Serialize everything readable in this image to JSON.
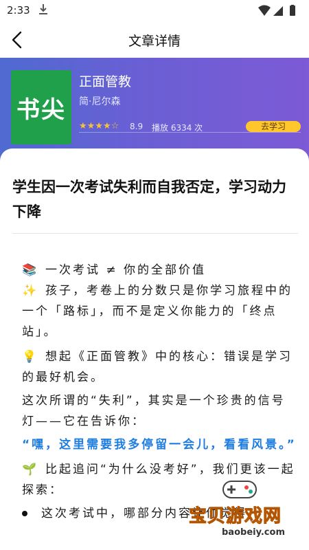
{
  "status_bar": {
    "time": "2:33"
  },
  "app_bar": {
    "title": "文章详情"
  },
  "book": {
    "cover_text": "书尖",
    "title": "正面管教",
    "author": "简·尼尔森",
    "stars": "★★★★☆",
    "rating": "8.9",
    "plays": "播放 6334 次",
    "learn_button": "去学习"
  },
  "article": {
    "title": "学生因一次考试失利而自我否定，学习动力下降",
    "lines": {
      "l1": "一次考试 ≠ 你的全部价值",
      "l2": "孩子，考卷上的分数只是你学习旅程中的一个「路标」，而不是定义你能力的「终点站」。",
      "l3": "想起《正面管教》中的核心：错误是学习的最好机会。",
      "l4": "这次所谓的“失利”，其实是一个珍贵的信号灯——它在告诉你：",
      "l5": "“嘿，这里需要我多停留一会儿，看看风景。”",
      "l6": "比起追问“为什么没考好”，我们更该一起探索：",
      "l7": "这次考试中，哪部分内容让你觉得"
    }
  },
  "watermark": {
    "text": "宝贝游戏网",
    "url": "baobeiy.com"
  },
  "icons": {
    "back": "back-arrow-icon",
    "download": "download-icon",
    "wifi": "wifi-icon",
    "signal": "signal-icon",
    "battery": "battery-icon",
    "books": "books-emoji-icon",
    "sparkles": "sparkles-emoji-icon",
    "bulb": "lightbulb-emoji-icon",
    "seedling": "seedling-emoji-icon"
  },
  "colors": {
    "header_start": "#4f6ad1",
    "header_end": "#7d5ad6",
    "cover": "#21a04c",
    "learn_button": "#ffc72c",
    "highlight": "#1f7de0"
  }
}
